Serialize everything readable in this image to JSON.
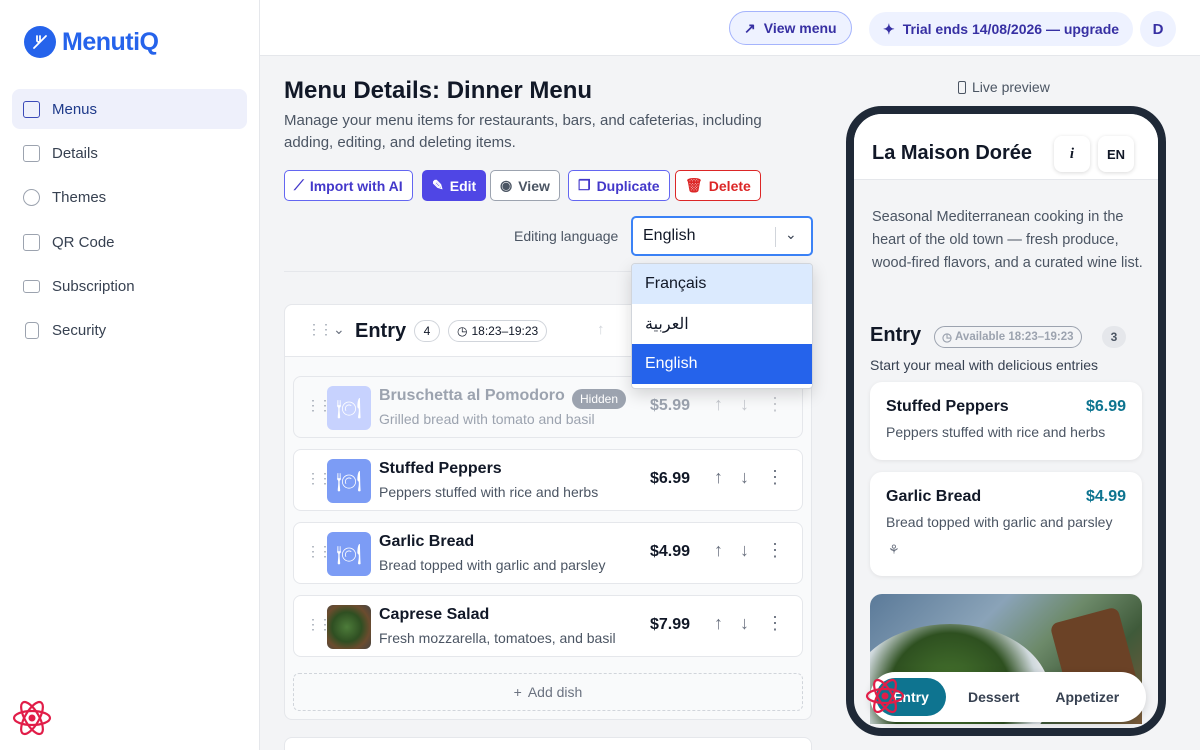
{
  "brand": {
    "name": "MenutiQ"
  },
  "sidebar": {
    "items": [
      {
        "label": "Menus",
        "icon": "menu-list-icon",
        "active": true
      },
      {
        "label": "Details",
        "icon": "store-icon"
      },
      {
        "label": "Themes",
        "icon": "palette-icon"
      },
      {
        "label": "QR Code",
        "icon": "qr-code-icon"
      },
      {
        "label": "Subscription",
        "icon": "credit-card-icon"
      },
      {
        "label": "Security",
        "icon": "lock-icon"
      }
    ]
  },
  "topbar": {
    "view_menu": "View menu",
    "trial": "Trial ends 14/08/2026 — upgrade",
    "avatar": "D"
  },
  "page": {
    "title": "Menu Details: Dinner Menu",
    "description": "Manage your menu items for restaurants, bars, and cafeterias, including adding, editing, and deleting items."
  },
  "actions": {
    "import": "Import with AI",
    "edit": "Edit",
    "view": "View",
    "duplicate": "Duplicate",
    "delete": "Delete"
  },
  "language": {
    "label": "Editing language",
    "selected": "English",
    "options": [
      "Français",
      "العربية",
      "English"
    ]
  },
  "section": {
    "name": "Entry",
    "count": "4",
    "time": "18:23–19:23",
    "add_dish": "Add dish",
    "dishes": [
      {
        "name": "Bruschetta al Pomodoro",
        "desc": "Grilled bread with tomato and basil",
        "price": "$5.99",
        "badge": "Hidden",
        "hidden": true
      },
      {
        "name": "Stuffed Peppers",
        "desc": "Peppers stuffed with rice and herbs",
        "price": "$6.99"
      },
      {
        "name": "Garlic Bread",
        "desc": "Bread topped with garlic and parsley",
        "price": "$4.99"
      },
      {
        "name": "Caprese Salad",
        "desc": "Fresh mozzarella, tomatoes, and basil",
        "price": "$7.99"
      }
    ]
  },
  "preview": {
    "label": "Live preview",
    "restaurant": "La Maison Dorée",
    "info_btn": "i",
    "lang_btn": "EN",
    "description": "Seasonal Mediterranean cooking in the heart of the old town — fresh produce, wood-fired flavors, and a curated wine list.",
    "section_name": "Entry",
    "availability": "Available 18:23–19:23",
    "count": "3",
    "section_desc": "Start your meal with delicious entries",
    "cards": [
      {
        "name": "Stuffed Peppers",
        "price": "$6.99",
        "desc": "Peppers stuffed with rice and herbs"
      },
      {
        "name": "Garlic Bread",
        "price": "$4.99",
        "desc": "Bread topped with garlic and parsley"
      }
    ],
    "tabs": [
      "Entry",
      "Dessert",
      "Appetizer"
    ]
  },
  "colors": {
    "brand": "#2563eb",
    "accent": "#4f46e5",
    "danger": "#dc2626",
    "price": "#0e7490"
  }
}
